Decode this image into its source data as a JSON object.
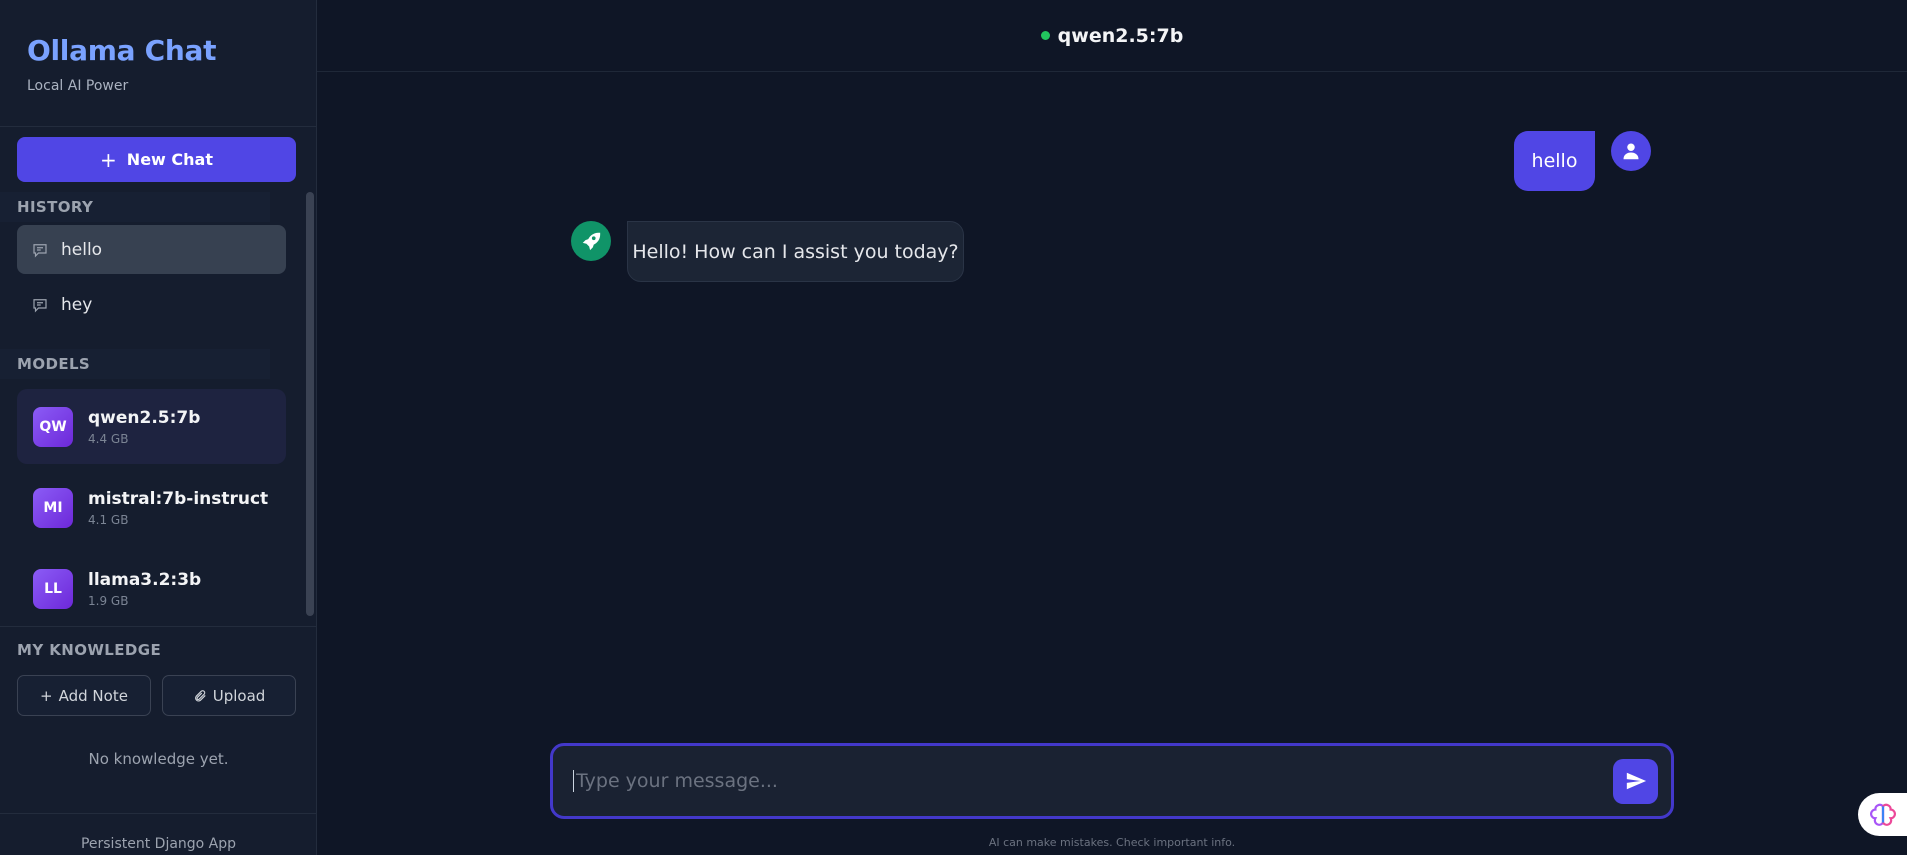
{
  "sidebar": {
    "brand_title": "Ollama Chat",
    "brand_subtitle": "Local AI Power",
    "new_chat_label": "New Chat",
    "history_label": "HISTORY",
    "history": [
      {
        "label": "hello",
        "active": true
      },
      {
        "label": "hey",
        "active": false
      }
    ],
    "models_label": "MODELS",
    "models": [
      {
        "initials": "QW",
        "name": "qwen2.5:7b",
        "size": "4.4 GB",
        "active": true
      },
      {
        "initials": "MI",
        "name": "mistral:7b-instruct",
        "size": "4.1 GB",
        "active": false
      },
      {
        "initials": "LL",
        "name": "llama3.2:3b",
        "size": "1.9 GB",
        "active": false
      }
    ],
    "knowledge_label": "MY KNOWLEDGE",
    "add_note_label": "Add Note",
    "upload_label": "Upload",
    "knowledge_empty": "No knowledge yet.",
    "footer": "Persistent Django App"
  },
  "header": {
    "model": "qwen2.5:7b",
    "status_color": "#22c55e"
  },
  "messages": [
    {
      "role": "user",
      "text": "hello"
    },
    {
      "role": "assistant",
      "text": "Hello! How can I assist you today?"
    }
  ],
  "composer": {
    "placeholder": "Type your message...",
    "disclaimer": "AI can make mistakes. Check important info."
  },
  "colors": {
    "accent": "#5046e5",
    "brand": "#7aa2ff",
    "bot_avatar": "#109468"
  }
}
